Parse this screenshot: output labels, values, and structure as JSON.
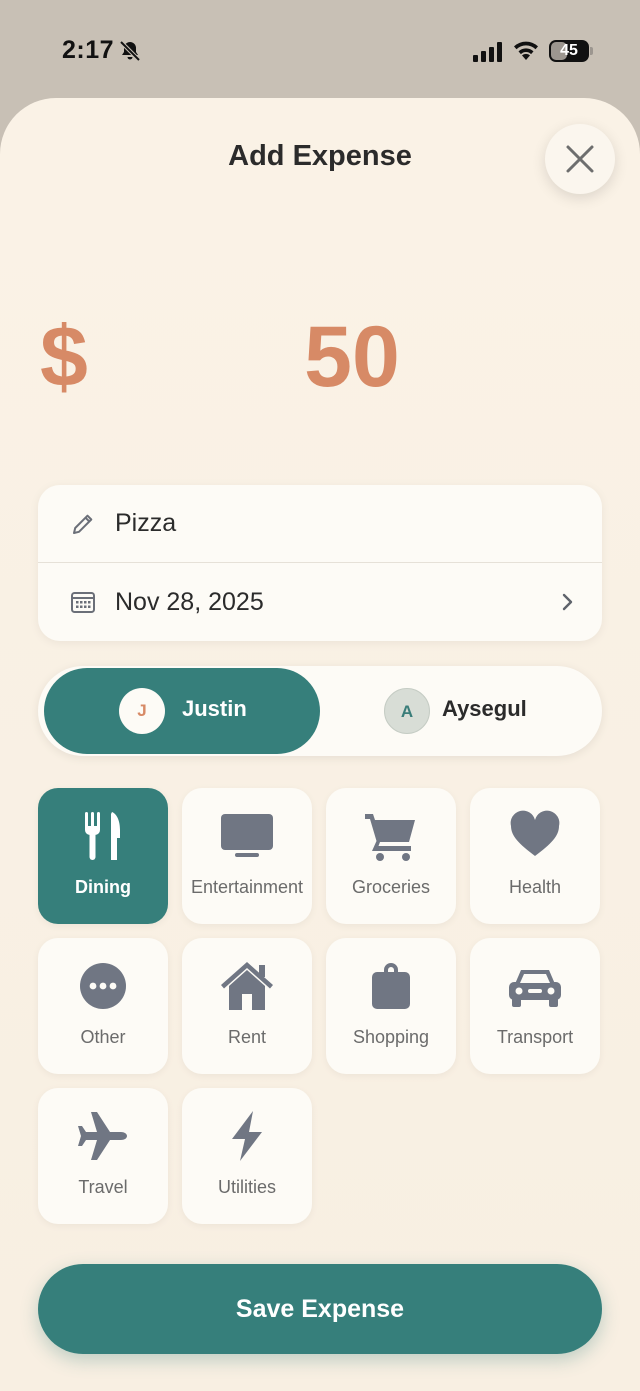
{
  "status_bar": {
    "time": "2:17",
    "battery": "45",
    "battery_level": 0.45,
    "icons": [
      "bell-slash-icon",
      "signal-icon",
      "wifi-icon",
      "battery-icon"
    ]
  },
  "sheet": {
    "title": "Add Expense",
    "close_icon": "close-icon"
  },
  "amount": {
    "currency": "$",
    "value": "50"
  },
  "details": {
    "description": "Pizza",
    "description_icon": "pencil-icon",
    "date": "Nov 28, 2025",
    "date_icon": "calendar-icon"
  },
  "payers": [
    {
      "initial": "J",
      "name": "Justin",
      "selected": true
    },
    {
      "initial": "A",
      "name": "Aysegul",
      "selected": false
    }
  ],
  "categories": [
    {
      "label": "Dining",
      "icon": "fork-knife-icon",
      "selected": true
    },
    {
      "label": "Entertainment",
      "icon": "tv-icon",
      "selected": false
    },
    {
      "label": "Groceries",
      "icon": "cart-icon",
      "selected": false
    },
    {
      "label": "Health",
      "icon": "heart-icon",
      "selected": false
    },
    {
      "label": "Other",
      "icon": "ellipsis-icon",
      "selected": false
    },
    {
      "label": "Rent",
      "icon": "house-icon",
      "selected": false
    },
    {
      "label": "Shopping",
      "icon": "bag-icon",
      "selected": false
    },
    {
      "label": "Transport",
      "icon": "car-icon",
      "selected": false
    },
    {
      "label": "Travel",
      "icon": "airplane-icon",
      "selected": false
    },
    {
      "label": "Utilities",
      "icon": "bolt-icon",
      "selected": false
    }
  ],
  "save_label": "Save Expense",
  "colors": {
    "accent": "#367f7b",
    "amount": "#d78a66",
    "background": "#faf2e6",
    "icon_gray": "#707683"
  }
}
